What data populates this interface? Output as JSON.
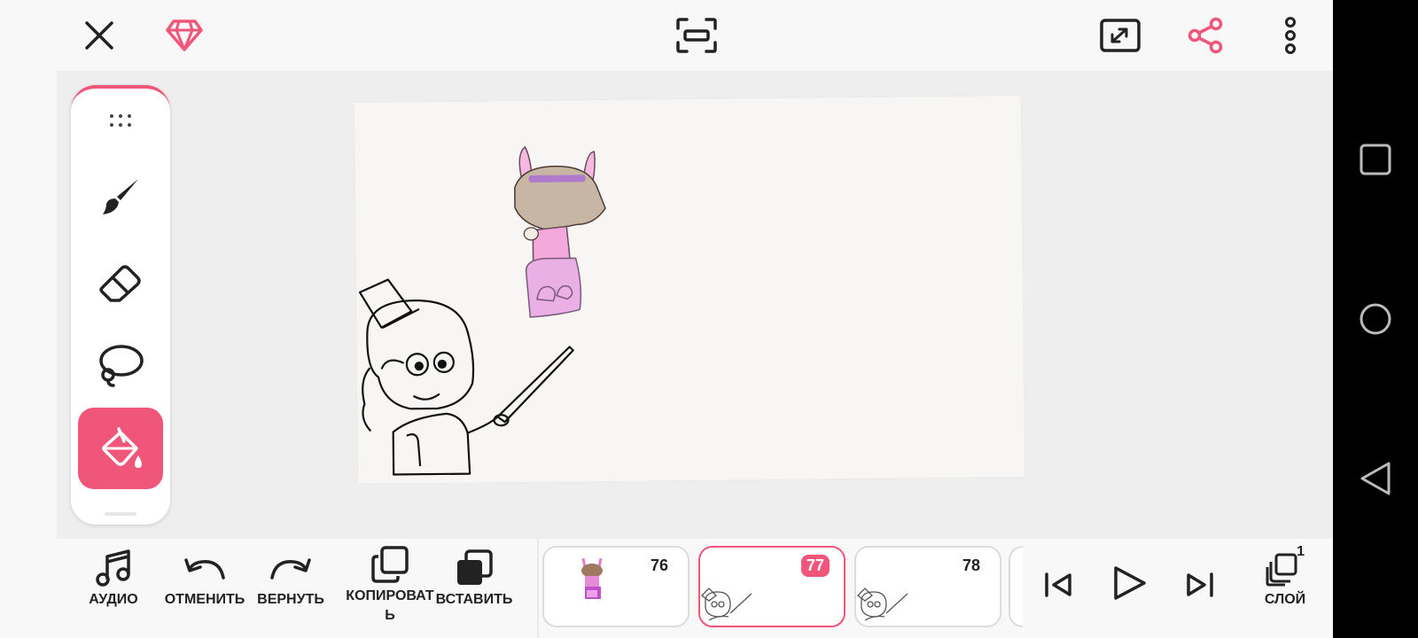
{
  "colors": {
    "accent": "#f0557a",
    "background": "#f8f8f8",
    "workspace": "#eeeeee"
  },
  "topbar": {
    "icons": [
      "close-icon",
      "diamond-premium-icon",
      "fit-screen-icon",
      "expand-icon",
      "share-icon",
      "more-vertical-icon"
    ]
  },
  "toolbox": {
    "tools": [
      "drag-handle-icon",
      "brush-icon",
      "eraser-icon",
      "lasso-icon",
      "fill-bucket-icon"
    ],
    "active_tool": "fill-bucket"
  },
  "bottombar": {
    "audio_label": "АУДИО",
    "undo_label": "ОТМЕНИТЬ",
    "redo_label": "ВЕРНУТЬ",
    "copy_label": "КОПИРОВАТЬ",
    "paste_label": "ВСТАВИТЬ",
    "layer_label": "СЛОЙ",
    "layer_count": "1"
  },
  "frames": [
    {
      "number": "76",
      "active": false
    },
    {
      "number": "77",
      "active": true
    },
    {
      "number": "78",
      "active": false
    }
  ],
  "playback": {
    "icons": [
      "skip-to-start-icon",
      "play-icon",
      "skip-to-end-icon"
    ]
  },
  "android_nav": {
    "icons": [
      "recents-icon",
      "home-icon",
      "back-icon"
    ]
  }
}
